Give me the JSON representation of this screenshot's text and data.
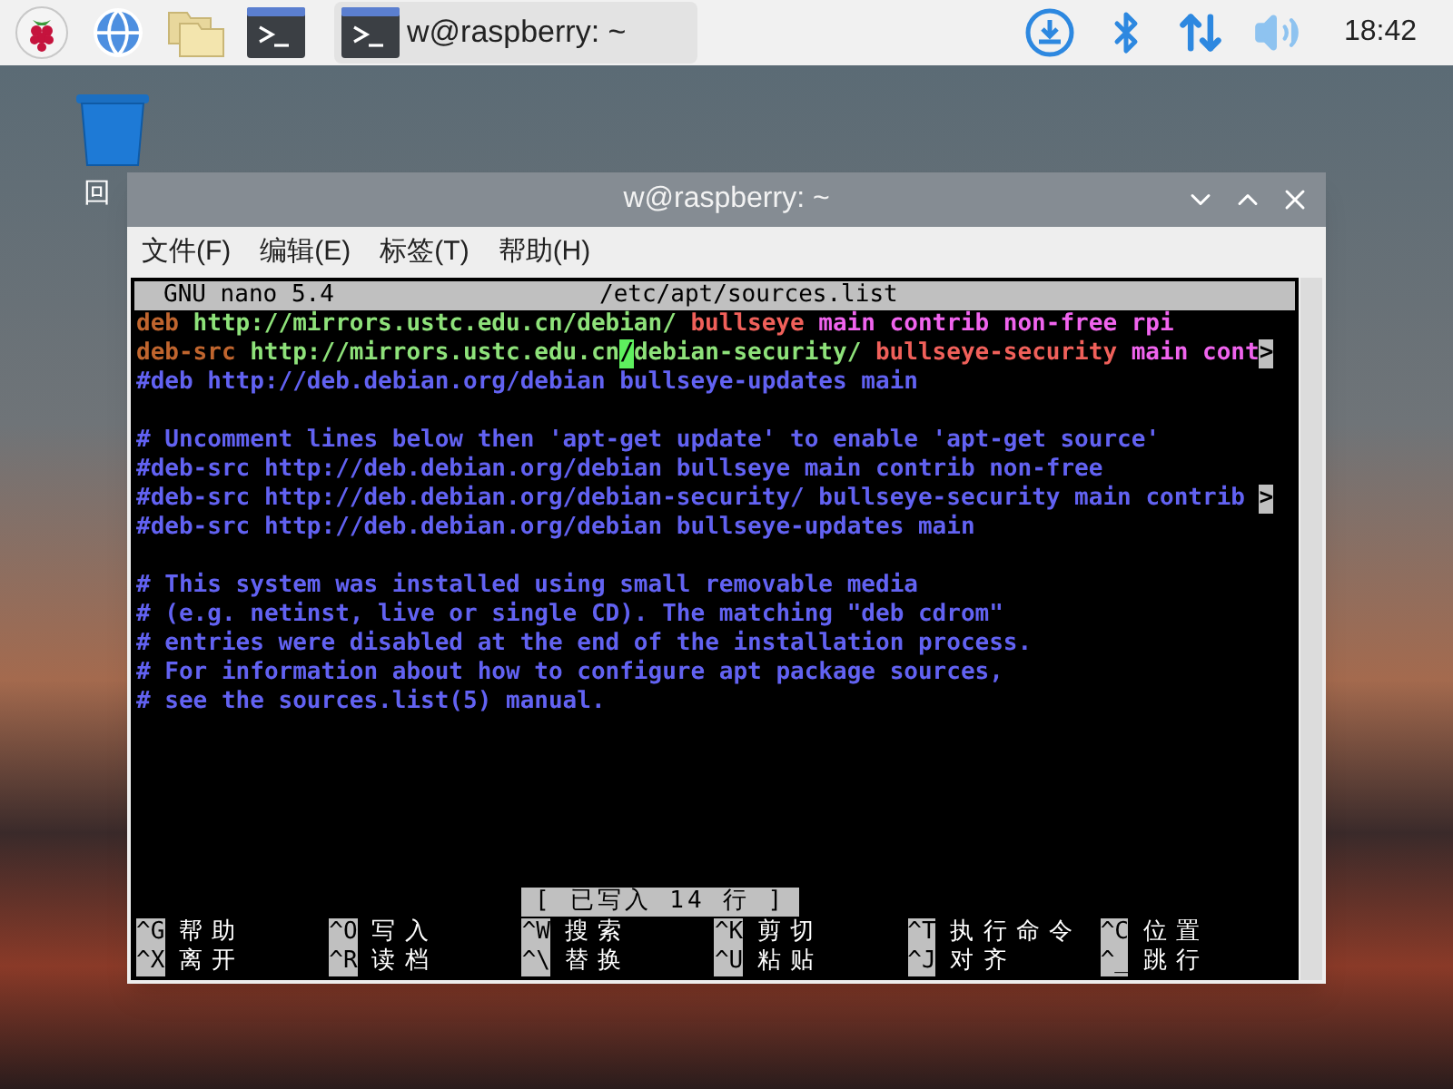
{
  "taskbar": {
    "task_title": "w@raspberry: ~",
    "clock": "18:42"
  },
  "desktop": {
    "trash_label": "回"
  },
  "window": {
    "title": "w@raspberry: ~",
    "menu": [
      "文件(F)",
      "编辑(E)",
      "标签(T)",
      "帮助(H)"
    ]
  },
  "nano": {
    "version": "GNU nano 5.4",
    "file": "/etc/apt/sources.list",
    "lines": [
      {
        "kind": "code",
        "segments": [
          {
            "text": "deb",
            "kind": "type"
          },
          {
            "text": "http://mirrors.ustc.edu.cn/debian/",
            "kind": "url"
          },
          {
            "text": "bullseye",
            "kind": "suite"
          },
          {
            "text": "main contrib non-free rpi",
            "kind": "component"
          }
        ]
      },
      {
        "kind": "code",
        "segments": [
          {
            "text": "deb-src",
            "kind": "type"
          },
          {
            "text": "http://mirrors.ustc.edu.cn",
            "kind": "url"
          },
          {
            "text": "/",
            "kind": "cursor"
          },
          {
            "text": "debian-security/",
            "kind": "url"
          },
          {
            "text": "bullseye-security",
            "kind": "suite"
          },
          {
            "text": "main cont",
            "kind": "component"
          },
          {
            "text": ">",
            "kind": "overflow"
          }
        ]
      },
      {
        "kind": "code",
        "segments": [
          {
            "text": "#deb http://deb.debian.org/debian bullseye-updates main",
            "kind": "comment"
          }
        ]
      },
      {
        "kind": "blank"
      },
      {
        "kind": "code",
        "segments": [
          {
            "text": "# Uncomment lines below then 'apt-get update' to enable 'apt-get source'",
            "kind": "comment"
          }
        ]
      },
      {
        "kind": "code",
        "segments": [
          {
            "text": "#deb-src http://deb.debian.org/debian bullseye main contrib non-free",
            "kind": "comment"
          }
        ]
      },
      {
        "kind": "code",
        "segments": [
          {
            "text": "#deb-src http://deb.debian.org/debian-security/ bullseye-security main contrib",
            "kind": "comment"
          },
          {
            "text": ">",
            "kind": "overflow"
          }
        ]
      },
      {
        "kind": "code",
        "segments": [
          {
            "text": "#deb-src http://deb.debian.org/debian bullseye-updates main",
            "kind": "comment"
          }
        ]
      },
      {
        "kind": "blank"
      },
      {
        "kind": "code",
        "segments": [
          {
            "text": "# This system was installed using small removable media",
            "kind": "comment"
          }
        ]
      },
      {
        "kind": "code",
        "segments": [
          {
            "text": "# (e.g. netinst, live or single CD). The matching \"deb cdrom\"",
            "kind": "comment"
          }
        ]
      },
      {
        "kind": "code",
        "segments": [
          {
            "text": "# entries were disabled at the end of the installation process.",
            "kind": "comment"
          }
        ]
      },
      {
        "kind": "code",
        "segments": [
          {
            "text": "# For information about how to configure apt package sources,",
            "kind": "comment"
          }
        ]
      },
      {
        "kind": "code",
        "segments": [
          {
            "text": "# see the sources.list(5) manual.",
            "kind": "comment"
          }
        ]
      }
    ],
    "status": "[ 已写入 14 行 ]",
    "shortcuts": [
      {
        "key": "^G",
        "label": "帮助"
      },
      {
        "key": "^O",
        "label": "写入"
      },
      {
        "key": "^W",
        "label": "搜索"
      },
      {
        "key": "^K",
        "label": "剪切"
      },
      {
        "key": "^T",
        "label": "执行命令"
      },
      {
        "key": "^C",
        "label": "位置"
      },
      {
        "key": "^X",
        "label": "离开"
      },
      {
        "key": "^R",
        "label": "读档"
      },
      {
        "key": "^\\",
        "label": "替换"
      },
      {
        "key": "^U",
        "label": "粘贴"
      },
      {
        "key": "^J",
        "label": "对齐"
      },
      {
        "key": "^_",
        "label": "跳行"
      }
    ]
  }
}
